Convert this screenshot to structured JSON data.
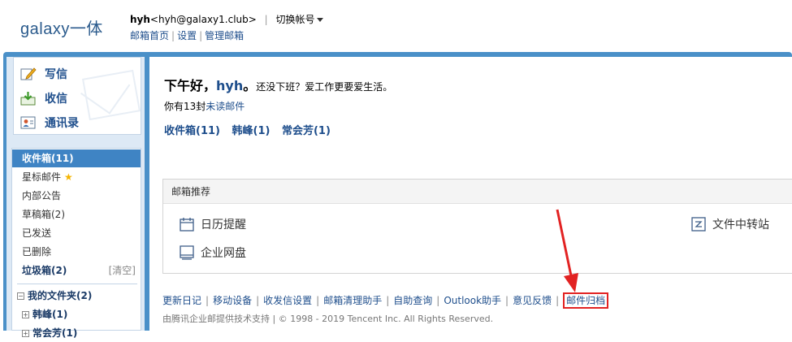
{
  "header": {
    "logo": "galaxy一体",
    "user_name": "hyh",
    "user_email": "<hyh@galaxy1.club>",
    "switch_account": "切换帐号",
    "links": [
      "邮箱首页",
      "设置",
      "管理邮箱"
    ]
  },
  "sidebar": {
    "actions": [
      {
        "label": "写信",
        "icon": "compose-icon"
      },
      {
        "label": "收信",
        "icon": "inbox-download-icon"
      },
      {
        "label": "通讯录",
        "icon": "contacts-icon"
      }
    ],
    "folders": [
      {
        "label": "收件箱(11)"
      },
      {
        "label": "星标邮件"
      },
      {
        "label": "内部公告"
      },
      {
        "label": "草稿箱(2)"
      },
      {
        "label": "已发送"
      },
      {
        "label": "已删除"
      },
      {
        "label": "垃圾箱(2)",
        "clear": "[清空]"
      }
    ],
    "my_folders": {
      "title": "我的文件夹(2)",
      "items": [
        "韩峰(1)",
        "常会芳(1)"
      ]
    }
  },
  "main": {
    "greeting": "下午好，",
    "greeting_name": "hyh",
    "greeting_end": "。",
    "greeting_tail": "还没下班？爱工作更要爱生活。",
    "unread_prefix": "你有13封",
    "unread_link": "未读邮件",
    "mailboxes": [
      "收件箱(11)",
      "韩峰(1)",
      "常会芳(1)"
    ],
    "recommend": {
      "title": "邮箱推荐",
      "tools": [
        {
          "label": "日历提醒",
          "icon": "calendar-icon"
        },
        {
          "label": "企业网盘",
          "icon": "cloud-disk-icon"
        },
        {
          "label": "文件中转站",
          "icon": "file-transfer-icon"
        }
      ]
    },
    "footer_links": [
      "更新日记",
      "移动设备",
      "收发信设置",
      "邮箱清理助手",
      "自助查询",
      "Outlook助手",
      "意见反馈",
      "邮件归档"
    ],
    "copyright": "由腾讯企业邮提供技术支持 | © 1998 - 2019 Tencent Inc. All Rights Reserved."
  },
  "colors": {
    "link": "#1e4e8c",
    "active_folder": "#3f84c4",
    "frame": "#4a90c8",
    "highlight_border": "#e22222"
  }
}
